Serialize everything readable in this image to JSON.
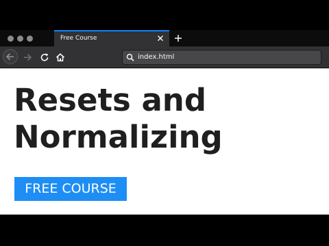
{
  "tab": {
    "title": "Free Course"
  },
  "address_bar": {
    "url": "index.html"
  },
  "page": {
    "headline_line1": "Resets and",
    "headline_line2": "Normalizing",
    "cta_label": "FREE COURSE"
  },
  "icons": {
    "window_controls": [
      "close-dot",
      "minimize-dot",
      "maximize-dot"
    ],
    "tab_close": "close-icon",
    "new_tab": "plus-icon",
    "back": "arrow-left-icon",
    "forward": "arrow-right-icon",
    "reload": "reload-icon",
    "home": "home-icon",
    "search": "search-icon"
  },
  "colors": {
    "accent": "#0a84ff",
    "cta_background": "#1e8ef5",
    "headline": "#1f1f1f",
    "chrome_dark": "#0c0c0d",
    "chrome_toolbar": "#323234"
  }
}
